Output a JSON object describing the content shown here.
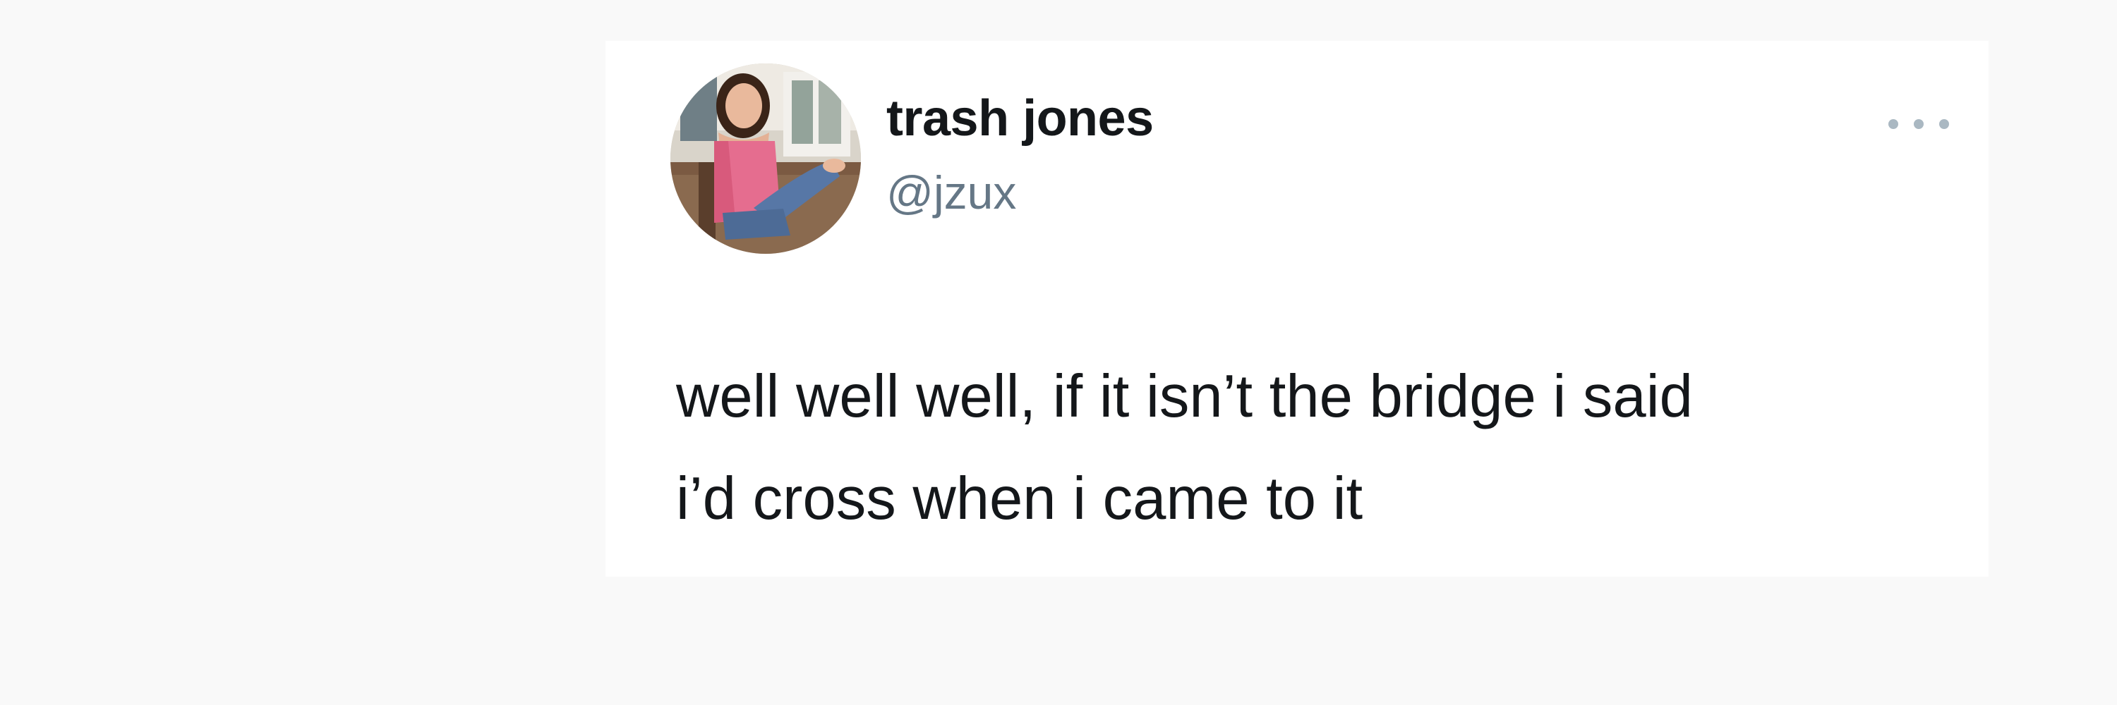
{
  "tweet": {
    "author": {
      "display_name": "trash jones",
      "handle": "@jzux",
      "avatar_icon": "profile-photo"
    },
    "more_icon": "more-options-icon",
    "text_lines": [
      "well well well, if it isn’t the bridge i said",
      "i’d cross when i came to it"
    ]
  },
  "colors": {
    "background": "#f9f9f9",
    "card": "#ffffff",
    "text_primary": "#14171a",
    "text_secondary": "#657786",
    "more_dots": "#aab8c2"
  }
}
